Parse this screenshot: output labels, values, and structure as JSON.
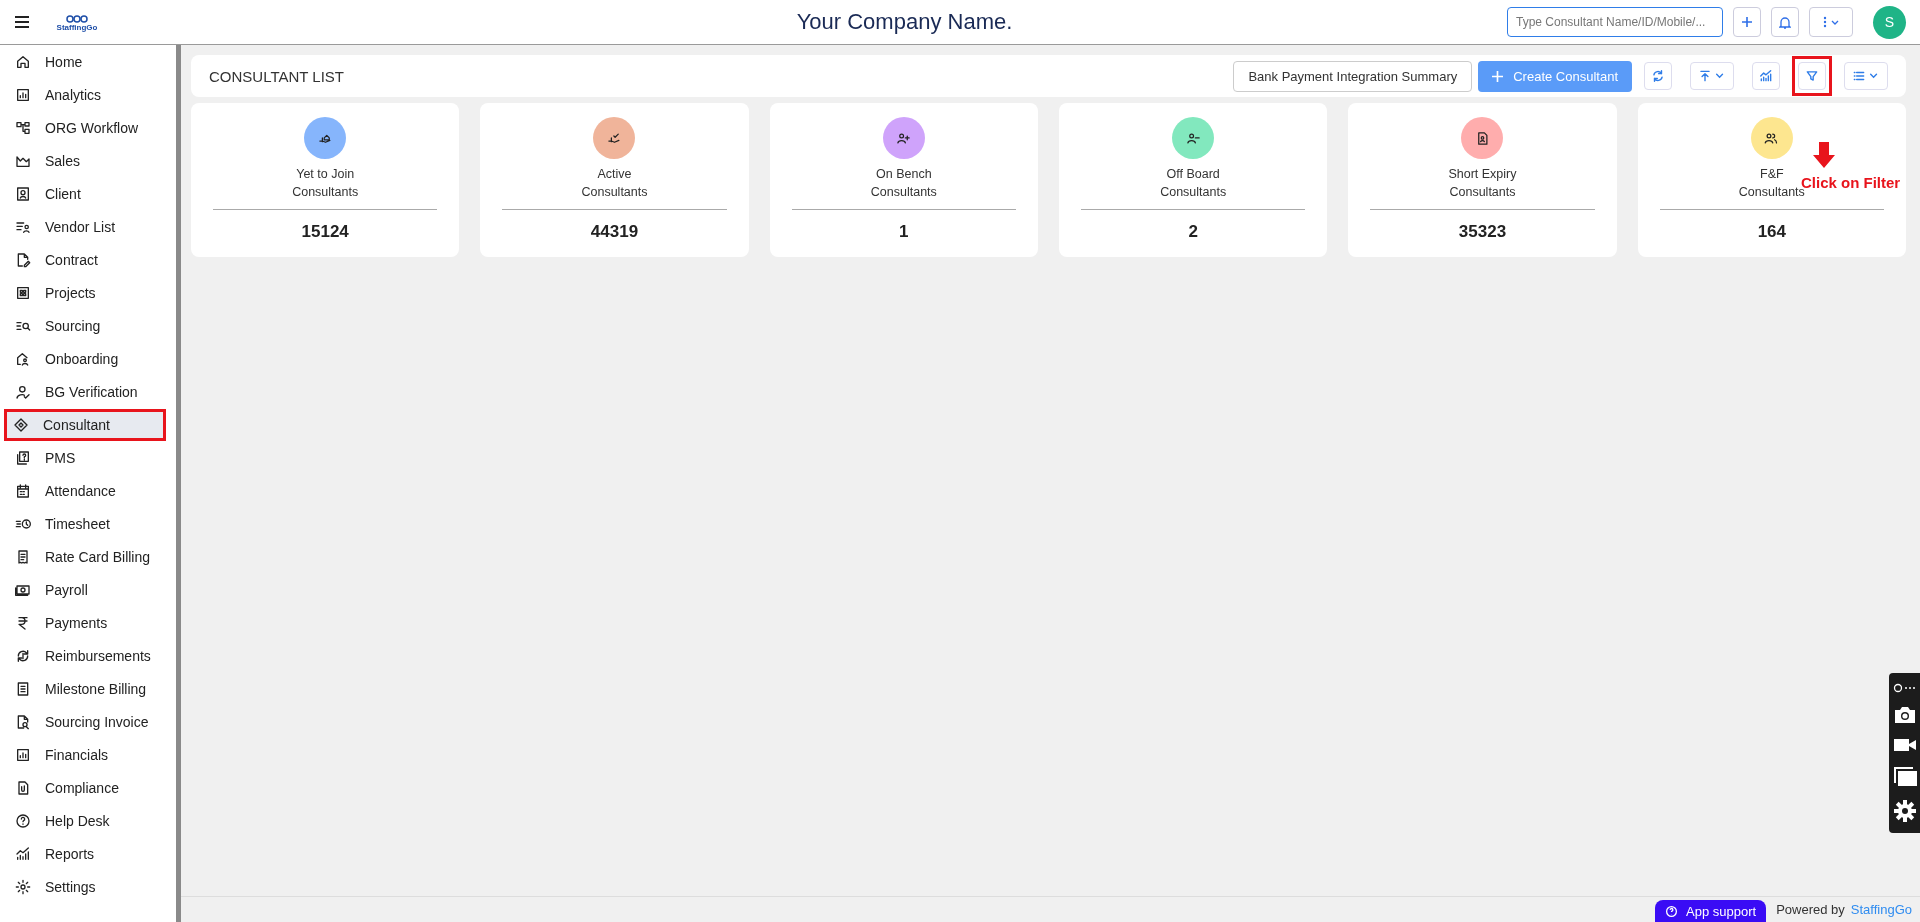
{
  "header": {
    "logo": "StaffingGo",
    "title": "Your Company Name.",
    "search": {
      "placeholder": "Type Consultant Name/ID/Mobile/..."
    },
    "avatar": "S"
  },
  "sidebar": {
    "items": [
      {
        "label": "Home",
        "selected": false,
        "highlighted": false
      },
      {
        "label": "Analytics",
        "selected": false,
        "highlighted": false
      },
      {
        "label": "ORG Workflow",
        "selected": false,
        "highlighted": false
      },
      {
        "label": "Sales",
        "selected": false,
        "highlighted": false
      },
      {
        "label": "Client",
        "selected": false,
        "highlighted": false
      },
      {
        "label": "Vendor List",
        "selected": false,
        "highlighted": false
      },
      {
        "label": "Contract",
        "selected": false,
        "highlighted": false
      },
      {
        "label": "Projects",
        "selected": false,
        "highlighted": false
      },
      {
        "label": "Sourcing",
        "selected": false,
        "highlighted": false
      },
      {
        "label": "Onboarding",
        "selected": false,
        "highlighted": false
      },
      {
        "label": "BG Verification",
        "selected": false,
        "highlighted": false
      },
      {
        "label": "Consultant",
        "selected": true,
        "highlighted": true
      },
      {
        "label": "PMS",
        "selected": false,
        "highlighted": false
      },
      {
        "label": "Attendance",
        "selected": false,
        "highlighted": false
      },
      {
        "label": "Timesheet",
        "selected": false,
        "highlighted": false
      },
      {
        "label": "Rate Card Billing",
        "selected": false,
        "highlighted": false
      },
      {
        "label": "Payroll",
        "selected": false,
        "highlighted": false
      },
      {
        "label": "Payments",
        "selected": false,
        "highlighted": false
      },
      {
        "label": "Reimbursements",
        "selected": false,
        "highlighted": false
      },
      {
        "label": "Milestone Billing",
        "selected": false,
        "highlighted": false
      },
      {
        "label": "Sourcing Invoice",
        "selected": false,
        "highlighted": false
      },
      {
        "label": "Financials",
        "selected": false,
        "highlighted": false
      },
      {
        "label": "Compliance",
        "selected": false,
        "highlighted": false
      },
      {
        "label": "Help Desk",
        "selected": false,
        "highlighted": false
      },
      {
        "label": "Reports",
        "selected": false,
        "highlighted": false
      },
      {
        "label": "Settings",
        "selected": false,
        "highlighted": false
      }
    ]
  },
  "page": {
    "title": "CONSULTANT LIST",
    "bank_button": "Bank Payment Integration Summary",
    "create_button": "Create Consultant",
    "icon_buttons": [
      {
        "highlighted": false
      },
      {
        "highlighted": false
      },
      {
        "highlighted": false
      },
      {
        "highlighted": true
      },
      {
        "highlighted": false
      }
    ]
  },
  "annotation": {
    "text": "Click on Filter"
  },
  "cards": [
    {
      "label": "Yet to Join\nConsultants",
      "count": "15124",
      "color": "#86b5fc"
    },
    {
      "label": "Active\nConsultants",
      "count": "44319",
      "color": "#f0b49a"
    },
    {
      "label": "On Bench\nConsultants",
      "count": "1",
      "color": "#cfa3fb"
    },
    {
      "label": "Off Board\nConsultants",
      "count": "2",
      "color": "#82e8be"
    },
    {
      "label": "Short Expiry\nConsultants",
      "count": "35323",
      "color": "#ffadad"
    },
    {
      "label": "F&F\nConsultants",
      "count": "164",
      "color": "#fde68f"
    }
  ],
  "footer": {
    "support_button": "App support",
    "powered_by": "Powered by",
    "brand": "StaffingGo"
  }
}
